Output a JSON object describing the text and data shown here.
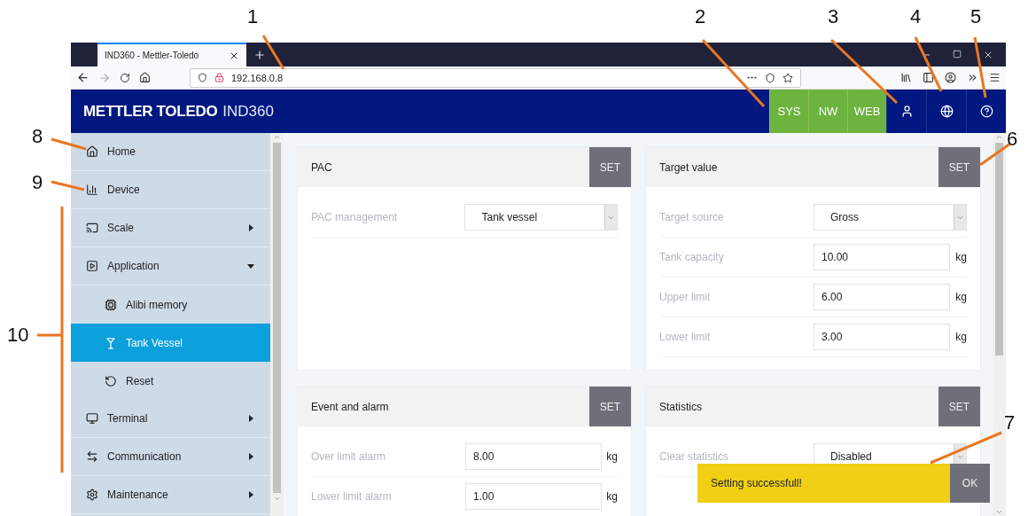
{
  "callouts": [
    {
      "label": "1"
    },
    {
      "label": "2"
    },
    {
      "label": "3"
    },
    {
      "label": "4"
    },
    {
      "label": "5"
    },
    {
      "label": "6"
    },
    {
      "label": "7"
    },
    {
      "label": "8"
    },
    {
      "label": "9"
    },
    {
      "label": "10"
    }
  ],
  "browser": {
    "tab_title": "IND360 - Mettler-Toledo",
    "url": "192.168.0.8"
  },
  "header": {
    "brand": "METTLER TOLEDO",
    "product": "IND360",
    "buttons": [
      {
        "label": "SYS"
      },
      {
        "label": "NW"
      },
      {
        "label": "WEB"
      }
    ]
  },
  "sidebar": {
    "items": [
      {
        "label": "Home",
        "kind": "link",
        "selected": false
      },
      {
        "label": "Device",
        "kind": "link",
        "selected": false
      },
      {
        "label": "Scale",
        "kind": "group",
        "expanded": false,
        "selected": false
      },
      {
        "label": "Application",
        "kind": "group",
        "expanded": true,
        "selected": false,
        "children": [
          {
            "label": "Alibi memory",
            "selected": false
          },
          {
            "label": "Tank Vessel",
            "selected": true
          },
          {
            "label": "Reset",
            "selected": false
          }
        ]
      },
      {
        "label": "Terminal",
        "kind": "group",
        "expanded": false,
        "selected": false
      },
      {
        "label": "Communication",
        "kind": "group",
        "expanded": false,
        "selected": false
      },
      {
        "label": "Maintenance",
        "kind": "group",
        "expanded": false,
        "selected": false
      }
    ]
  },
  "cards": [
    {
      "title": "PAC",
      "button": "SET",
      "fields": [
        {
          "label": "PAC management",
          "kind": "select",
          "value": "Tank vessel"
        }
      ]
    },
    {
      "title": "Target value",
      "button": "SET",
      "fields": [
        {
          "label": "Target source",
          "kind": "select",
          "value": "Gross"
        },
        {
          "label": "Tank capacity",
          "kind": "input",
          "value": "10.00",
          "unit": "kg"
        },
        {
          "label": "Upper limit",
          "kind": "input",
          "value": "6.00",
          "unit": "kg"
        },
        {
          "label": "Lower limit",
          "kind": "input",
          "value": "3.00",
          "unit": "kg"
        }
      ]
    },
    {
      "title": "Event and alarm",
      "button": "SET",
      "fields": [
        {
          "label": "Over limit alarm",
          "kind": "input",
          "value": "8.00",
          "unit": "kg"
        },
        {
          "label": "Lower limit alarm",
          "kind": "input",
          "value": "1.00",
          "unit": "kg"
        }
      ]
    },
    {
      "title": "Statistics",
      "button": "SET",
      "fields": [
        {
          "label": "Clear statistics",
          "kind": "select",
          "value": "Disabled"
        }
      ]
    }
  ],
  "toast": {
    "message": "Setting successfull!",
    "button": "OK"
  }
}
